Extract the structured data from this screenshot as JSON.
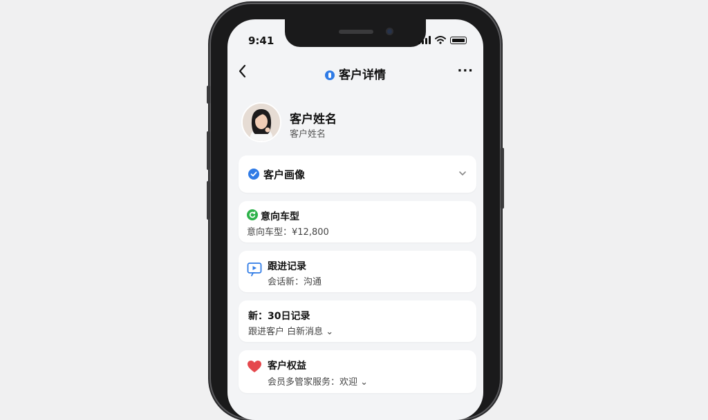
{
  "status_bar": {
    "time": "9:41"
  },
  "nav": {
    "back_icon": "chevron-left-icon",
    "title": "客户详情",
    "more": "···"
  },
  "profile": {
    "name": "客户姓名",
    "subtitle": "客户姓名"
  },
  "cards": [
    {
      "title": "客户画像",
      "icon": "check-badge-icon",
      "icon_color": "#2f7be6",
      "chevron": "⌄"
    },
    {
      "title": "意向车型",
      "subtitle": "意向车型：¥12,800",
      "icon": "refresh-icon",
      "icon_color": "#2db24a"
    },
    {
      "title": "跟进记录",
      "subtitle": "会话新：沟通",
      "icon": "monitor-icon",
      "icon_color": "#2f7be6"
    },
    {
      "title": "新：30日记录",
      "subtitle": "跟进客户 白新消息 ⌄"
    },
    {
      "title": "客户权益",
      "subtitle": "会员多管家服务：欢迎 ⌄",
      "icon": "heart-icon",
      "icon_color": "#e5484d"
    }
  ],
  "colors": {
    "accent": "#2f7be6",
    "background": "#f3f4f6",
    "card": "#ffffff"
  }
}
